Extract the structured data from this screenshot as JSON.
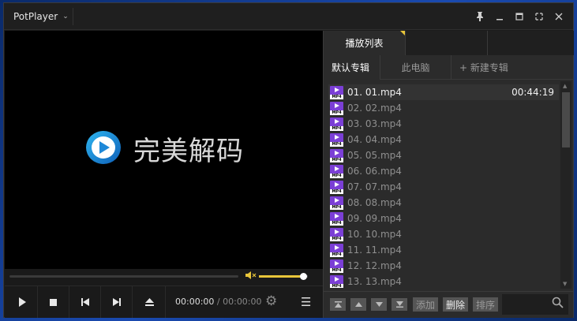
{
  "app": {
    "title": "PotPlayer"
  },
  "logo": {
    "text": "完美解码",
    "icon": "play-logo-icon"
  },
  "player": {
    "position": "00:00:00",
    "separator": " / ",
    "duration": "00:00:00",
    "volume_fraction": 0.9
  },
  "panel": {
    "tabs": [
      {
        "label": "播放列表"
      },
      {
        "label": ""
      },
      {
        "label": ""
      }
    ],
    "albums": [
      {
        "label": "默认专辑"
      },
      {
        "label": "此电脑"
      },
      {
        "label": "+ 新建专辑"
      }
    ],
    "items": [
      {
        "label": "01. 01.mp4",
        "duration": "00:44:19"
      },
      {
        "label": "02. 02.mp4"
      },
      {
        "label": "03. 03.mp4"
      },
      {
        "label": "04. 04.mp4"
      },
      {
        "label": "05. 05.mp4"
      },
      {
        "label": "06. 06.mp4"
      },
      {
        "label": "07. 07.mp4"
      },
      {
        "label": "08. 08.mp4"
      },
      {
        "label": "09. 09.mp4"
      },
      {
        "label": "10. 10.mp4"
      },
      {
        "label": "11. 11.mp4"
      },
      {
        "label": "12. 12.mp4"
      },
      {
        "label": "13. 13.mp4"
      }
    ],
    "file_badge": "MP4",
    "buttons": {
      "add": "添加",
      "delete": "删除",
      "sort": "排序"
    }
  },
  "colors": {
    "accent": "#e8c53a",
    "badge": "#7b3fd6"
  }
}
